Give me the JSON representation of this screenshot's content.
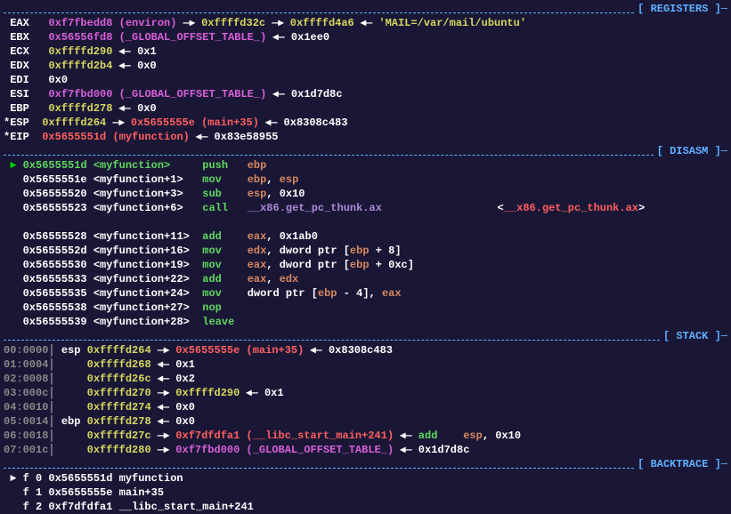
{
  "sections": {
    "registers": "REGISTERS",
    "disasm": "DISASM",
    "stack": "STACK",
    "backtrace": "BACKTRACE"
  },
  "registers": {
    "EAX": {
      "name": "EAX",
      "val": "0xf7fbedd8",
      "sym": "(environ)",
      "arrow1": "→",
      "p1": "0xffffd32c",
      "arrow2": "→",
      "p2": "0xffffd4a6",
      "arrow3": "←",
      "str": "'MAIL=/var/mail/ubuntu'"
    },
    "EBX": {
      "name": "EBX",
      "val": "0x56556fd8",
      "sym": "(_GLOBAL_OFFSET_TABLE_)",
      "arrow": "←",
      "p": "0x1ee0"
    },
    "ECX": {
      "name": "ECX",
      "val": "0xffffd290",
      "arrow": "←",
      "p": "0x1"
    },
    "EDX": {
      "name": "EDX",
      "val": "0xffffd2b4",
      "arrow": "←",
      "p": "0x0"
    },
    "EDI": {
      "name": "EDI",
      "val": "0x0"
    },
    "ESI": {
      "name": "ESI",
      "val": "0xf7fbd000",
      "sym": "(_GLOBAL_OFFSET_TABLE_)",
      "arrow": "←",
      "p": "0x1d7d8c"
    },
    "EBP": {
      "name": "EBP",
      "val": "0xffffd278",
      "arrow": "←",
      "p": "0x0"
    },
    "ESP": {
      "name": "*ESP",
      "val": "0xffffd264",
      "arrow1": "→",
      "p1": "0x5655555e",
      "sym": "(main+35)",
      "arrow2": "←",
      "p2": "0x8308c483"
    },
    "EIP": {
      "name": "*EIP",
      "val": "0x5655551d",
      "sym": "(myfunction)",
      "arrow": "←",
      "p": "0x83e58955"
    }
  },
  "disasm": [
    {
      "marker": "►",
      "addr": "0x5655551d",
      "sym": "<myfunction>",
      "mnem": "push",
      "ops": "ebp"
    },
    {
      "addr": "0x5655551e",
      "sym": "<myfunction+1>",
      "mnem": "mov",
      "ops_r1": "ebp",
      "ops_c": ", ",
      "ops_r2": "esp"
    },
    {
      "addr": "0x56555520",
      "sym": "<myfunction+3>",
      "mnem": "sub",
      "ops_r1": "esp",
      "ops_c": ", ",
      "ops_imm": "0x10"
    },
    {
      "addr": "0x56555523",
      "sym": "<myfunction+6>",
      "mnem": "call",
      "ops_target": "__x86.get_pc_thunk.ax",
      "hint_open": "<",
      "hint": "__x86.get_pc_thunk.ax",
      "hint_close": ">"
    },
    {
      "blank": true
    },
    {
      "addr": "0x56555528",
      "sym": "<myfunction+11>",
      "mnem": "add",
      "ops_r1": "eax",
      "ops_c": ", ",
      "ops_imm": "0x1ab0"
    },
    {
      "addr": "0x5655552d",
      "sym": "<myfunction+16>",
      "mnem": "mov",
      "ops_r1": "edx",
      "ops_c": ", ",
      "mem_pre": "dword ptr [",
      "mem_reg": "ebp",
      "mem_op": " + ",
      "mem_off": "8",
      "mem_post": "]"
    },
    {
      "addr": "0x56555530",
      "sym": "<myfunction+19>",
      "mnem": "mov",
      "ops_r1": "eax",
      "ops_c": ", ",
      "mem_pre": "dword ptr [",
      "mem_reg": "ebp",
      "mem_op": " + ",
      "mem_off": "0xc",
      "mem_post": "]"
    },
    {
      "addr": "0x56555533",
      "sym": "<myfunction+22>",
      "mnem": "add",
      "ops_r1": "eax",
      "ops_c": ", ",
      "ops_r2": "edx"
    },
    {
      "addr": "0x56555535",
      "sym": "<myfunction+24>",
      "mnem": "mov",
      "mem_pre": "dword ptr [",
      "mem_reg": "ebp",
      "mem_op": " - ",
      "mem_off": "4",
      "mem_post": "]",
      "ops_c": ", ",
      "ops_r2": "eax",
      "mem_first": true
    },
    {
      "addr": "0x56555538",
      "sym": "<myfunction+27>",
      "mnem": "nop"
    },
    {
      "addr": "0x56555539",
      "sym": "<myfunction+28>",
      "mnem": "leave"
    }
  ],
  "stack": [
    {
      "off": "00:0000",
      "reg": "esp",
      "addr": "0xffffd264",
      "arr": "→",
      "p1": "0x5655555e",
      "sym": "(main+35)",
      "arr2": "←",
      "p2": "0x8308c483"
    },
    {
      "off": "01:0004",
      "addr": "0xffffd268",
      "arr": "←",
      "p1": "0x1"
    },
    {
      "off": "02:0008",
      "addr": "0xffffd26c",
      "arr": "←",
      "p1": "0x2"
    },
    {
      "off": "03:000c",
      "addr": "0xffffd270",
      "arr": "→",
      "p1": "0xffffd290",
      "arr2": "←",
      "p2": "0x1"
    },
    {
      "off": "04:0010",
      "addr": "0xffffd274",
      "arr": "←",
      "p1": "0x0"
    },
    {
      "off": "05:0014",
      "reg": "ebp",
      "addr": "0xffffd278",
      "arr": "←",
      "p1": "0x0"
    },
    {
      "off": "06:0018",
      "addr": "0xffffd27c",
      "arr": "→",
      "p1": "0xf7dfdfa1",
      "sym": "(__libc_start_main+241)",
      "arr2": "←",
      "mnem": "add",
      "ops_r": "esp",
      "ops_c": ", ",
      "ops_imm": "0x10"
    },
    {
      "off": "07:001c",
      "addr": "0xffffd280",
      "arr": "→",
      "p1": "0xf7fbd000",
      "sym": "(_GLOBAL_OFFSET_TABLE_)",
      "arr2": "←",
      "p2": "0x1d7d8c"
    }
  ],
  "backtrace": [
    {
      "marker": "►",
      "idx": "f 0",
      "addr": "0x5655551d",
      "name": "myfunction"
    },
    {
      "idx": "f 1",
      "addr": "0x5655555e",
      "name": "main+35"
    },
    {
      "idx": "f 2",
      "addr": "0xf7dfdfa1",
      "name": "__libc_start_main+241"
    }
  ]
}
